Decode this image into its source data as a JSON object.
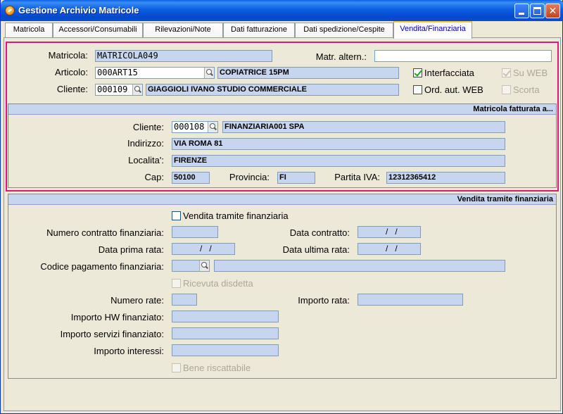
{
  "window": {
    "title": "Gestione Archivio Matricole"
  },
  "tabs": [
    {
      "label": "Matricola"
    },
    {
      "label": "Accessori/Consumabili"
    },
    {
      "label": "Rilevazioni/Note"
    },
    {
      "label": "Dati fatturazione"
    },
    {
      "label": "Dati spedizione/Cespite"
    },
    {
      "label": "Vendita/Finanziaria"
    }
  ],
  "header": {
    "matricola_label": "Matricola:",
    "matricola_value": "MATRICOLA049",
    "matr_altern_label": "Matr. altern.:",
    "matr_altern_value": "",
    "articolo_label": "Articolo:",
    "articolo_code": "000ART15",
    "articolo_desc": "COPIATRICE 15PM",
    "cliente_label": "Cliente:",
    "cliente_code": "000109",
    "cliente_desc": "GIAGGIOLI IVANO STUDIO COMMERCIALE",
    "interfacciata_label": "Interfacciata",
    "interfacciata_checked": true,
    "su_web_label": "Su WEB",
    "ord_aut_web_label": "Ord. aut. WEB",
    "scorta_label": "Scorta"
  },
  "fatturata": {
    "title": "Matricola fatturata a...",
    "cliente_label": "Cliente:",
    "cliente_code": "000108",
    "cliente_desc": "FINANZIARIA001 SPA",
    "indirizzo_label": "Indirizzo:",
    "indirizzo_value": "VIA ROMA 81",
    "localita_label": "Localita':",
    "localita_value": "FIRENZE",
    "cap_label": "Cap:",
    "cap_value": "50100",
    "provincia_label": "Provincia:",
    "provincia_value": "FI",
    "piva_label": "Partita IVA:",
    "piva_value": "12312365412"
  },
  "finanziaria": {
    "title": "Vendita tramite finanziaria",
    "vendita_label": "Vendita tramite finanziaria",
    "numero_contratto_label": "Numero contratto finanziaria:",
    "data_contratto_label": "Data contratto:",
    "data_contratto_value": "  /   /",
    "data_prima_rata_label": "Data prima rata:",
    "data_prima_rata_value": "  /   /",
    "data_ultima_rata_label": "Data ultima rata:",
    "data_ultima_rata_value": "  /   /",
    "codice_pagamento_label": "Codice pagamento finanziaria:",
    "ricevuta_label": "Ricevuta disdetta",
    "numero_rate_label": "Numero rate:",
    "importo_rata_label": "Importo rata:",
    "importo_hw_label": "Importo HW finanziato:",
    "importo_servizi_label": "Importo servizi finanziato:",
    "importo_interessi_label": "Importo interessi:",
    "bene_label": "Bene riscattabile"
  },
  "colors": {
    "titlebar": "#0a5fe6",
    "highlight_frame": "#e0177a",
    "field_bg": "#c7d6ee",
    "window_bg": "#ece9d8"
  }
}
